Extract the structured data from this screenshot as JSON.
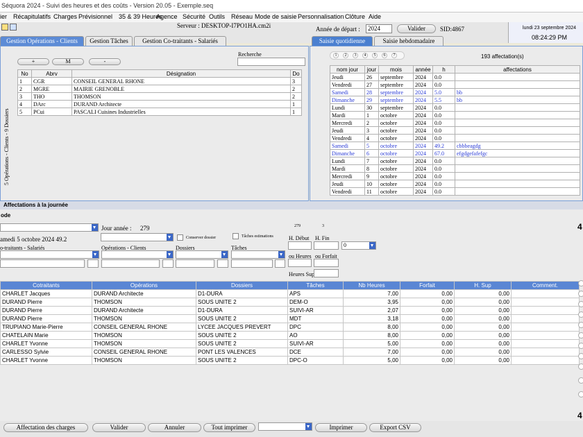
{
  "window": {
    "title": "Séquora 2024 - Suivi des heures et des coûts - Version 20.05 - Exemple.seq"
  },
  "menu": [
    "ier",
    "Récapitulatifs",
    "Charges",
    "Prévisionnel",
    "35 & 39 Heures",
    "Agence",
    "Sécurité",
    "Outils",
    "Réseau",
    "Mode de saisie",
    "Personnalisation",
    "Clôture",
    "Aide"
  ],
  "toolbar": {
    "server": "Serveur : DESKTOP-I7PO1HA.cm2i",
    "annee_label": "Année de départ :",
    "annee_value": "2024",
    "valider": "Valider",
    "sid": "SID:4867",
    "date": "lundi 23 septembre 2024",
    "time": "08:24:29 PM"
  },
  "tabsLeft": [
    "Gestion Opérations - Clients",
    "Gestion Tâches",
    "Gestion Co-traitants - Salariés"
  ],
  "tabsRight": [
    "Saisie quotidienne",
    "Saisie hebdomadaire"
  ],
  "left": {
    "recherche": "Recherche",
    "buttons": [
      "+",
      "M",
      "-"
    ],
    "side_label": "5 Opérations - Clients - 9 Dossiers",
    "headers": [
      "No",
      "Abrv",
      "Désignation",
      "Do"
    ],
    "rows": [
      [
        "1",
        "CGR",
        "CONSEIL GENERAL RHONE",
        "3"
      ],
      [
        "2",
        "MGRE",
        "MAIRIE GRENOBLE",
        "2"
      ],
      [
        "3",
        "THO",
        "THOMSON",
        "2"
      ],
      [
        "4",
        "DArc",
        "DURAND Architecte",
        "1"
      ],
      [
        "5",
        "PCui",
        "PASCALI Cuisines Industrielles",
        "1"
      ]
    ]
  },
  "right": {
    "pages": [
      "1",
      "2",
      "3",
      "4",
      "5",
      "6",
      "7"
    ],
    "count": "193 affectation(s)",
    "headers": [
      "nom jour",
      "jour",
      "mois",
      "année",
      "h",
      "affectations"
    ],
    "rows": [
      [
        "Jeudi",
        "26",
        "septembre",
        "2024",
        "0.0",
        ""
      ],
      [
        "Vendredi",
        "27",
        "septembre",
        "2024",
        "0.0",
        ""
      ],
      [
        "Samedi",
        "28",
        "septembre",
        "2024",
        "5.0",
        "bb"
      ],
      [
        "Dimanche",
        "29",
        "septembre",
        "2024",
        "5.5",
        "bb"
      ],
      [
        "Lundi",
        "30",
        "septembre",
        "2024",
        "0.0",
        ""
      ],
      [
        "Mardi",
        "1",
        "octobre",
        "2024",
        "0.0",
        ""
      ],
      [
        "Mercredi",
        "2",
        "octobre",
        "2024",
        "0.0",
        ""
      ],
      [
        "Jeudi",
        "3",
        "octobre",
        "2024",
        "0.0",
        ""
      ],
      [
        "Vendredi",
        "4",
        "octobre",
        "2024",
        "0.0",
        ""
      ],
      [
        "Samedi",
        "5",
        "octobre",
        "2024",
        "49.2",
        "cbbbeagdg"
      ],
      [
        "Dimanche",
        "6",
        "octobre",
        "2024",
        "67.0",
        "efgdgefafefgc"
      ],
      [
        "Lundi",
        "7",
        "octobre",
        "2024",
        "0.0",
        ""
      ],
      [
        "Mardi",
        "8",
        "octobre",
        "2024",
        "0.0",
        ""
      ],
      [
        "Mercredi",
        "9",
        "octobre",
        "2024",
        "0.0",
        ""
      ],
      [
        "Jeudi",
        "10",
        "octobre",
        "2024",
        "0.0",
        ""
      ],
      [
        "Vendredi",
        "11",
        "octobre",
        "2024",
        "0.0",
        ""
      ]
    ]
  },
  "affect": {
    "title": "Affectations à la journée",
    "mode": "ode",
    "jour_annee_label": "Jour année :",
    "jour_annee_value": "279",
    "mini1": "279",
    "mini2": "3",
    "date_text": "amedi 5 octobre 2024 49.2",
    "conserver": "Conserver dossier",
    "taches_est": "Tâches estimations",
    "hdebut": "H. Début",
    "hfin": "H. Fin",
    "zero": "0",
    "lbl_cotraitants": "o-traitants - Salariés",
    "lbl_operations": "Opérations - Clients",
    "lbl_dossiers": "Dossiers",
    "lbl_taches": "Tâches",
    "ou_heures": "ou Heures",
    "ou_forfait": "ou Forfait",
    "heures_sup": "Heures Sup",
    "right_num": "4",
    "right_num2": "4",
    "headers": [
      "Cotraitants",
      "Opérations",
      "Dossiers",
      "Tâches",
      "Nb Heures",
      "Forfait",
      "H. Sup",
      "Comment."
    ],
    "rows": [
      [
        "CHARLET Jacques",
        "DURAND Architecte",
        "D1-DURA",
        "APS",
        "7,00",
        "0,00",
        "0,00",
        ""
      ],
      [
        "DURAND Pierre",
        "THOMSON",
        "SOUS UNITE 2",
        "DEM-O",
        "3,95",
        "0,00",
        "0,00",
        ""
      ],
      [
        "DURAND Pierre",
        "DURAND Architecte",
        "D1-DURA",
        "SUIVI-AR",
        "2,07",
        "0,00",
        "0,00",
        ""
      ],
      [
        "DURAND Pierre",
        "THOMSON",
        "SOUS UNITE 2",
        "MDT",
        "3,18",
        "0,00",
        "0,00",
        ""
      ],
      [
        "TRUPIANO Marie-Pierre",
        "CONSEIL GENERAL RHONE",
        "LYCEE JACQUES PREVERT",
        "DPC",
        "8,00",
        "0,00",
        "0,00",
        ""
      ],
      [
        "CHATELAIN Marie",
        "THOMSON",
        "SOUS UNITE 2",
        "AO",
        "8,00",
        "0,00",
        "0,00",
        ""
      ],
      [
        "CHARLET Yvonne",
        "THOMSON",
        "SOUS UNITE 2",
        "SUIVI-AR",
        "5,00",
        "0,00",
        "0,00",
        ""
      ],
      [
        "CARLESSO Sylvie",
        "CONSEIL GENERAL RHONE",
        "PONT LES VALENCES",
        "DCE",
        "7,00",
        "0,00",
        "0,00",
        ""
      ],
      [
        "CHARLET Yvonne",
        "THOMSON",
        "SOUS UNITE 2",
        "DPC-O",
        "5,00",
        "0,00",
        "0,00",
        ""
      ]
    ]
  },
  "bottom": {
    "buttons": [
      "Affectation des charges",
      "Valider",
      "Annuler",
      "Tout imprimer",
      "Imprimer",
      "Export CSV"
    ]
  },
  "colors": {
    "accent": "#5a86d4",
    "weekend": "#2a3bd6"
  }
}
